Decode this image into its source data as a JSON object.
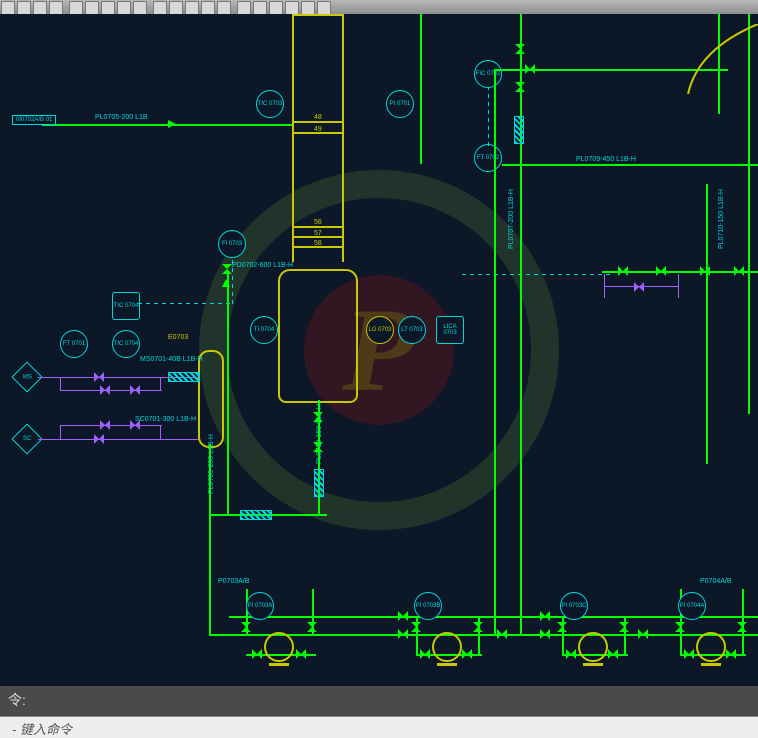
{
  "command_prompt": "令:",
  "command_placeholder": "- 键入命令",
  "watermark_letter": "P",
  "instruments": {
    "tic0703": "TIC\n0703",
    "fic0702": "FIC\n0702",
    "pi0701": "PI\n0701",
    "ft0702": "FT\n0702",
    "tic0704a": "TIC\n0704",
    "tic0704b": "TIC\n0704",
    "ft0701": "FT\n0701",
    "fi0703": "FI\n0703",
    "ti0704": "TI\n0704",
    "lg0703": "LG\n0703",
    "lt0703": "LT\n0703",
    "lica0703": "LICA\n0703",
    "pi0703a": "PI\n0703A",
    "pi0703b": "PI\n0703B",
    "pi0703c": "PI\n0703C",
    "pi0704a": "PI\n0704A",
    "ms": "MS",
    "sc": "SC",
    "tag01": "0f0702A/B\n01"
  },
  "labels": {
    "line1": "PL0705-200 L1B",
    "line2": "PD0702-600 L1B-H",
    "line3": "MS0701-40B L1B-H",
    "line4": "SC0701-300 L1B-H",
    "line5": "PL0709-200 L1B-H",
    "line6": "PL0710-150 L1B-H",
    "line7": "PL0709-450 L1B-H",
    "line8": "PL0707-200 L1B-H",
    "line9": "PL0710-150 L1B-H",
    "e0703": "E0703",
    "p0703ab": "P0703A/B",
    "p0704ab": "P0704A/B",
    "l48": "48",
    "l49": "49",
    "l56": "56",
    "l57": "57",
    "l58": "58"
  }
}
